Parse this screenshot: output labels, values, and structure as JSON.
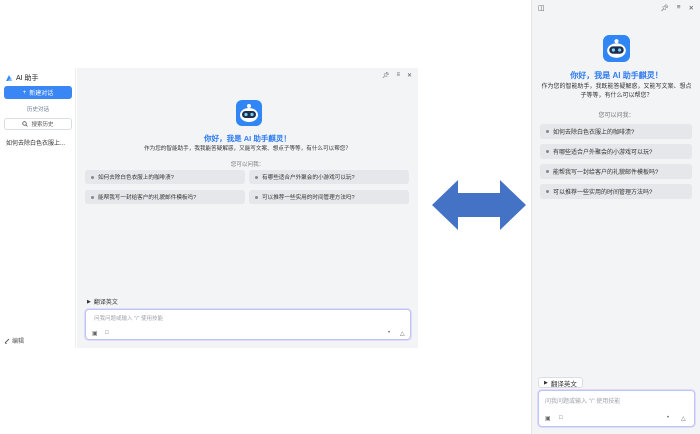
{
  "left_app": {
    "sidebar": {
      "title": "AI 助手",
      "new_chat_label": "新建对话",
      "history_label": "历史对话",
      "search_label": "搜索历史",
      "history_items": [
        "如何去除白色衣服上..."
      ],
      "edit_label": "编辑"
    },
    "greeting": "你好，我是 AI 助手麒灵！",
    "intro": "作为您的智能助手，我我能答疑解惑，又能写文案、想点子等等，有什么可以帮您？",
    "ask_label": "您可以问我：",
    "suggestions": [
      "如何去除白色衣服上的咖啡渍?",
      "有哪些适合户外聚会的小游戏可以玩?",
      "能帮我写一封给客户的礼貌邮件模板吗?",
      "可以推荐一些实用的时间管理方法吗?"
    ],
    "skill_chip": "翻译英文",
    "input_placeholder": "问我问题或输入 \"/\" 使用技能"
  },
  "right_panel": {
    "greeting": "你好，我是 AI 助手麒灵！",
    "intro": "作为您的智能助手，我既能答疑解惑，又能写文案、想点子等等，有什么可以帮您？",
    "ask_label": "您可以问我：",
    "suggestions": [
      "如何去除白色衣服上的咖啡渍?",
      "有哪些适合户外聚会的小游戏可以玩?",
      "能帮我写一封给客户的礼貌邮件模板吗?",
      "可以推荐一些实用的时间管理方法吗?"
    ],
    "skill_chip": "翻译英文",
    "input_placeholder": "问我问题或输入 \"/\" 使用技能"
  },
  "colors": {
    "accent": "#3a86f5",
    "greeting": "#2f7cf0",
    "arrow": "#4472c4",
    "panel_bg": "#f3f4f6",
    "suggestion_bg": "#e6e7ea"
  },
  "icons": [
    "pin-icon",
    "menu-icon",
    "close-icon",
    "sidebar-toggle-icon",
    "image-icon",
    "file-icon",
    "mic-icon",
    "send-icon",
    "play-icon",
    "search-icon",
    "plus-icon"
  ]
}
